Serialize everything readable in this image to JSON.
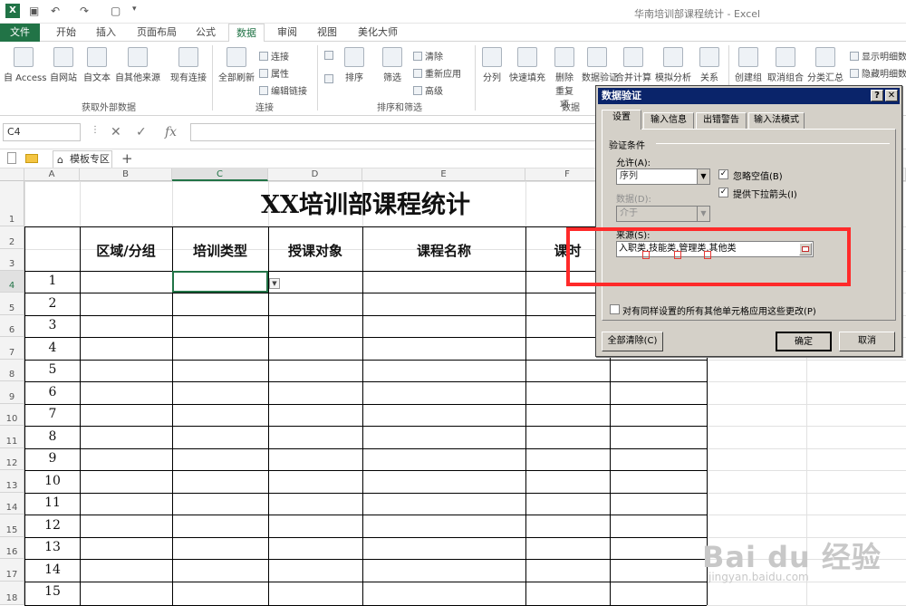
{
  "window": {
    "title": "华南培训部课程统计 - Excel"
  },
  "ribbon_tabs": [
    "文件",
    "开始",
    "插入",
    "页面布局",
    "公式",
    "数据",
    "审阅",
    "视图",
    "美化大师"
  ],
  "ribbon": {
    "get_external": {
      "items": [
        "自 Access",
        "自网站",
        "自文本",
        "自其他来源",
        "现有连接"
      ],
      "group_label": "获取外部数据"
    },
    "connections": {
      "refresh": "全部刷新",
      "small": [
        "连接",
        "属性",
        "编辑链接"
      ],
      "group_label": "连接"
    },
    "sort_filter": {
      "sort": "排序",
      "filter": "筛选",
      "small": [
        "清除",
        "重新应用",
        "高级"
      ],
      "group_label": "排序和筛选"
    },
    "data_tools": {
      "items": [
        "分列",
        "快速填充",
        "删除重复项",
        "数据验证",
        "合并计算",
        "模拟分析",
        "关系"
      ],
      "group_label": "数据"
    },
    "outline": {
      "items": [
        "创建组",
        "取消组合",
        "分类汇总"
      ],
      "small": [
        "显示明细数据",
        "隐藏明细数据"
      ]
    }
  },
  "formula_bar": {
    "name_box": "C4",
    "cancel": "✕",
    "enter": "✓",
    "fx": "fx"
  },
  "sheet_strip": {
    "tab_label": "模板专区",
    "add": "+"
  },
  "grid": {
    "columns": [
      "A",
      "B",
      "C",
      "D",
      "E",
      "F"
    ],
    "rows": [
      "1",
      "2",
      "3",
      "4",
      "5",
      "6",
      "7",
      "8",
      "9",
      "10",
      "11",
      "12",
      "13",
      "14",
      "15",
      "16",
      "17",
      "18"
    ],
    "sheet_title": "XX培训部课程统计",
    "headers": [
      "区域/分组",
      "培训类型",
      "授课对象",
      "课程名称",
      "课时"
    ],
    "numbers": [
      "1",
      "2",
      "3",
      "4",
      "5",
      "6",
      "7",
      "8",
      "9",
      "10",
      "11",
      "12",
      "13",
      "14",
      "15"
    ]
  },
  "dialog": {
    "title": "数据验证",
    "help": "?",
    "close": "✕",
    "tabs": [
      "设置",
      "输入信息",
      "出错警告",
      "输入法模式"
    ],
    "section_label": "验证条件",
    "allow_label": "允许(A):",
    "allow_value": "序列",
    "data_label": "数据(D):",
    "data_value": "介于",
    "ignore_blank": "忽略空值(B)",
    "dropdown": "提供下拉箭头(I)",
    "source_label": "来源(S):",
    "source_value": "入职类,技能类,管理类,其他类",
    "apply_all": "对有同样设置的所有其他单元格应用这些更改(P)",
    "clear_all": "全部清除(C)",
    "ok": "确定",
    "cancel": "取消"
  },
  "watermark": {
    "brand": "Bai du 经验",
    "url": "jingyan.baidu.com"
  },
  "colors": {
    "excel_green": "#217346",
    "highlight_red": "#ff2a2a",
    "dialog_title_bg": "#0a246a"
  }
}
